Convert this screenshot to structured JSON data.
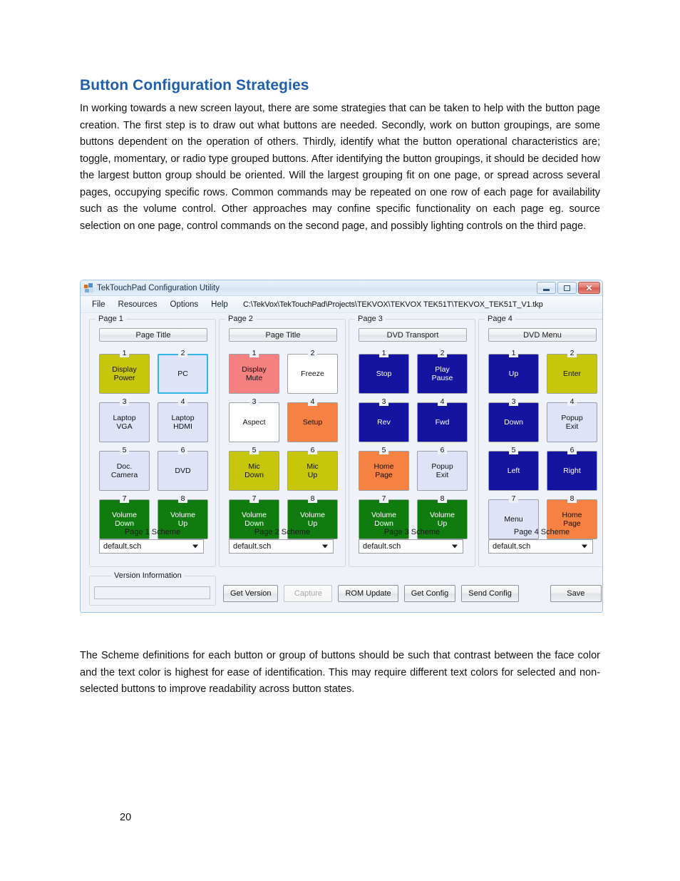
{
  "document": {
    "heading": "Button Configuration Strategies",
    "paragraph_1": "In working towards a new screen layout, there are some strategies that can be taken to help with the button page creation. The first step is to draw out what buttons are needed. Secondly, work on button groupings, are some buttons dependent on the operation of others. Thirdly, identify what the button operational characteristics are; toggle, momentary, or radio type grouped buttons. After identifying the button groupings, it should be decided how the largest button group should be oriented. Will the largest grouping fit on one page, or spread across several pages, occupying specific rows. Common commands may be repeated on one row of each page for availability such as the volume control. Other approaches may confine specific functionality on each page eg. source selection on one page, control commands on the second page, and possibly lighting controls on the third page.",
    "paragraph_2": "The Scheme definitions for each button or group of buttons should be such that contrast between the face color and the text color is highest for ease of identification. This may require different text colors for selected and non-selected buttons to improve readability across button states.",
    "page_number": "20",
    "heading_color": "#1F5FA9"
  },
  "app": {
    "title": "TekTouchPad Configuration Utility",
    "window_controls": {
      "minimize": "Minimize",
      "maximize": "Maximize",
      "close": "Close"
    },
    "menu": [
      "File",
      "Resources",
      "Options",
      "Help"
    ],
    "project_path": "C:\\TekVox\\TekTouchPad\\Projects\\TEKVOX\\TEKVOX TEK51T\\TEKVOX_TEK51T_V1.tkp",
    "version_group_label": "Version Information",
    "version_value": "",
    "actions": [
      {
        "label": "Get Version",
        "enabled": true
      },
      {
        "label": "Capture",
        "enabled": false
      },
      {
        "label": "ROM Update",
        "enabled": true
      },
      {
        "label": "Get Config",
        "enabled": true
      },
      {
        "label": "Send Config",
        "enabled": true
      }
    ],
    "save_label": "Save",
    "pages": [
      {
        "group_label": "Page 1",
        "page_title": "Page Title",
        "scheme_label": "Page 1 Scheme",
        "scheme_value": "default.sch",
        "buttons": [
          {
            "num": "1",
            "line1": "Display",
            "line2": "Power",
            "face": "#c6c60c",
            "text": "#111111",
            "selected": false
          },
          {
            "num": "2",
            "line1": "PC",
            "line2": "",
            "face": "#dfe3f7",
            "text": "#111111",
            "selected": true
          },
          {
            "num": "3",
            "line1": "Laptop",
            "line2": "VGA",
            "face": "#dfe3f7",
            "text": "#111111",
            "selected": false
          },
          {
            "num": "4",
            "line1": "Laptop",
            "line2": "HDMI",
            "face": "#dfe3f7",
            "text": "#111111",
            "selected": false
          },
          {
            "num": "5",
            "line1": "Doc.",
            "line2": "Camera",
            "face": "#dfe3f7",
            "text": "#111111",
            "selected": false
          },
          {
            "num": "6",
            "line1": "DVD",
            "line2": "",
            "face": "#dfe3f7",
            "text": "#111111",
            "selected": false
          },
          {
            "num": "7",
            "line1": "Volume",
            "line2": "Down",
            "face": "#107c10",
            "text": "#ffffff",
            "selected": false
          },
          {
            "num": "8",
            "line1": "Volume",
            "line2": "Up",
            "face": "#107c10",
            "text": "#ffffff",
            "selected": false
          }
        ]
      },
      {
        "group_label": "Page 2",
        "page_title": "Page Title",
        "scheme_label": "Page 2 Scheme",
        "scheme_value": "default.sch",
        "buttons": [
          {
            "num": "1",
            "line1": "Display",
            "line2": "Mute",
            "face": "#f58080",
            "text": "#111111",
            "selected": false
          },
          {
            "num": "2",
            "line1": "Freeze",
            "line2": "",
            "face": "#ffffff",
            "text": "#111111",
            "selected": false
          },
          {
            "num": "3",
            "line1": "Aspect",
            "line2": "",
            "face": "#ffffff",
            "text": "#111111",
            "selected": false
          },
          {
            "num": "4",
            "line1": "Setup",
            "line2": "",
            "face": "#f58142",
            "text": "#111111",
            "selected": false
          },
          {
            "num": "5",
            "line1": "Mic",
            "line2": "Down",
            "face": "#c6c60c",
            "text": "#111111",
            "selected": false
          },
          {
            "num": "6",
            "line1": "Mic",
            "line2": "Up",
            "face": "#c6c60c",
            "text": "#111111",
            "selected": false
          },
          {
            "num": "7",
            "line1": "Volume",
            "line2": "Down",
            "face": "#107c10",
            "text": "#ffffff",
            "selected": false
          },
          {
            "num": "8",
            "line1": "Volume",
            "line2": "Up",
            "face": "#107c10",
            "text": "#ffffff",
            "selected": false
          }
        ]
      },
      {
        "group_label": "Page 3",
        "page_title": "DVD Transport",
        "scheme_label": "Page 3 Scheme",
        "scheme_value": "default.sch",
        "buttons": [
          {
            "num": "1",
            "line1": "Stop",
            "line2": "",
            "face": "#1414a0",
            "text": "#ffffff",
            "selected": false
          },
          {
            "num": "2",
            "line1": "Play",
            "line2": "Pause",
            "face": "#1414a0",
            "text": "#ffffff",
            "selected": false
          },
          {
            "num": "3",
            "line1": "Rev",
            "line2": "",
            "face": "#1414a0",
            "text": "#ffffff",
            "selected": false
          },
          {
            "num": "4",
            "line1": "Fwd",
            "line2": "",
            "face": "#1414a0",
            "text": "#ffffff",
            "selected": false
          },
          {
            "num": "5",
            "line1": "Home",
            "line2": "Page",
            "face": "#f58142",
            "text": "#111111",
            "selected": false
          },
          {
            "num": "6",
            "line1": "Popup",
            "line2": "Exit",
            "face": "#dfe3f7",
            "text": "#111111",
            "selected": false
          },
          {
            "num": "7",
            "line1": "Volume",
            "line2": "Down",
            "face": "#107c10",
            "text": "#ffffff",
            "selected": false
          },
          {
            "num": "8",
            "line1": "Volume",
            "line2": "Up",
            "face": "#107c10",
            "text": "#ffffff",
            "selected": false
          }
        ]
      },
      {
        "group_label": "Page 4",
        "page_title": "DVD Menu",
        "scheme_label": "Page 4 Scheme",
        "scheme_value": "default.sch",
        "buttons": [
          {
            "num": "1",
            "line1": "Up",
            "line2": "",
            "face": "#1414a0",
            "text": "#ffffff",
            "selected": false
          },
          {
            "num": "2",
            "line1": "Enter",
            "line2": "",
            "face": "#c6c60c",
            "text": "#111111",
            "selected": false
          },
          {
            "num": "3",
            "line1": "Down",
            "line2": "",
            "face": "#1414a0",
            "text": "#ffffff",
            "selected": false
          },
          {
            "num": "4",
            "line1": "Popup",
            "line2": "Exit",
            "face": "#dfe3f7",
            "text": "#111111",
            "selected": false
          },
          {
            "num": "5",
            "line1": "Left",
            "line2": "",
            "face": "#1414a0",
            "text": "#ffffff",
            "selected": false
          },
          {
            "num": "6",
            "line1": "Right",
            "line2": "",
            "face": "#1414a0",
            "text": "#ffffff",
            "selected": false
          },
          {
            "num": "7",
            "line1": "Menu",
            "line2": "",
            "face": "#dfe3f7",
            "text": "#111111",
            "selected": false
          },
          {
            "num": "8",
            "line1": "Home",
            "line2": "Page",
            "face": "#f58142",
            "text": "#111111",
            "selected": false
          }
        ]
      }
    ]
  }
}
